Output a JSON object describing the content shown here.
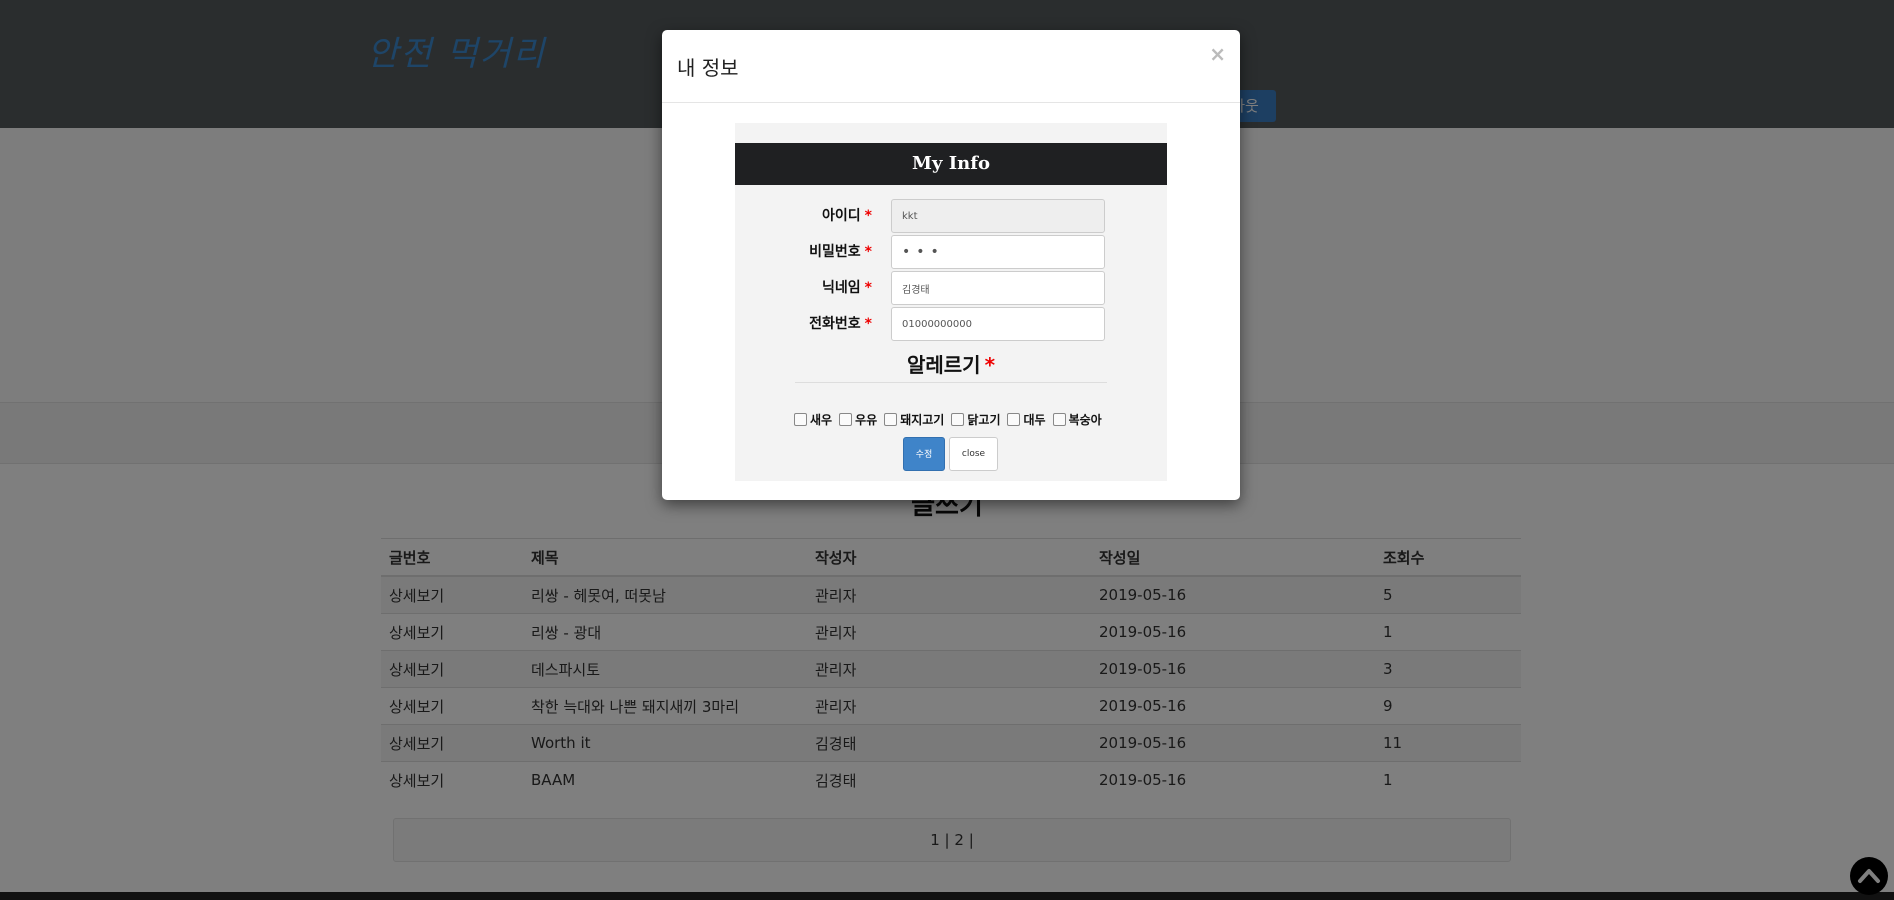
{
  "site": {
    "title": "안전 먹거리",
    "nav_button": "아웃"
  },
  "board": {
    "write_link": "글쓰기",
    "columns": [
      "글번호",
      "제목",
      "작성자",
      "작성일",
      "조회수"
    ],
    "rows": [
      [
        "상세보기",
        "리쌍 - 헤못여, 떠못남",
        "관리자",
        "2019-05-16",
        "5"
      ],
      [
        "상세보기",
        "리쌍 - 광대",
        "관리자",
        "2019-05-16",
        "1"
      ],
      [
        "상세보기",
        "데스파시토",
        "관리자",
        "2019-05-16",
        "3"
      ],
      [
        "상세보기",
        "착한 늑대와 나쁜 돼지새끼 3마리",
        "관리자",
        "2019-05-16",
        "9"
      ],
      [
        "상세보기",
        "Worth it",
        "김경태",
        "2019-05-16",
        "11"
      ],
      [
        "상세보기",
        "BAAM",
        "김경태",
        "2019-05-16",
        "1"
      ]
    ],
    "pagination": "1 | 2 |"
  },
  "modal": {
    "title": "내 정보",
    "close_symbol": "×",
    "panel_heading": "My Info",
    "fields": [
      {
        "label": "아이디",
        "required": "*",
        "value": "kkt",
        "readonly": true
      },
      {
        "label": "비밀번호",
        "required": "*",
        "value": "•••",
        "readonly": false
      },
      {
        "label": "닉네임",
        "required": "*",
        "value": "김경태",
        "readonly": false
      },
      {
        "label": "전화번호",
        "required": "*",
        "value": "01000000000",
        "readonly": false
      }
    ],
    "allergy": {
      "title": "알레르기",
      "required": "*",
      "options": [
        "새우",
        "우유",
        "돼지고기",
        "닭고기",
        "대두",
        "복숭아"
      ]
    },
    "submit_label": "수정",
    "close_label": "close"
  }
}
